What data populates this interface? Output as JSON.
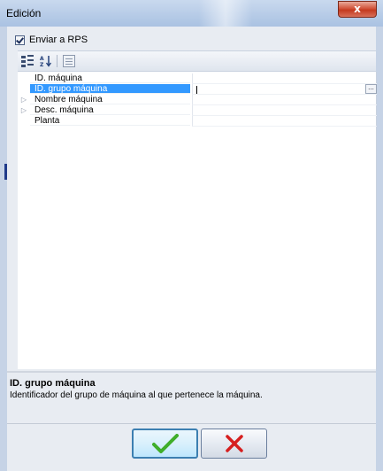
{
  "window": {
    "title": "Edición",
    "close_glyph": "x"
  },
  "send_checkbox": {
    "label": "Enviar a RPS",
    "checked": true
  },
  "toolbar": {
    "icons": [
      "categorized-icon",
      "alphabetical-sort-icon",
      "property-pages-icon"
    ],
    "sort_glyph": "A↓Z"
  },
  "properties": [
    {
      "name": "ID. máquina",
      "value": "",
      "expandable": false,
      "selected": false
    },
    {
      "name": "ID. grupo máquina",
      "value": "",
      "expandable": false,
      "selected": true
    },
    {
      "name": "Nombre máquina",
      "value": "",
      "expandable": true,
      "selected": false
    },
    {
      "name": "Desc. máquina",
      "value": "",
      "expandable": true,
      "selected": false
    },
    {
      "name": "Planta",
      "value": "",
      "expandable": false,
      "selected": false
    }
  ],
  "ellipsis_label": "...",
  "description": {
    "title": "ID. grupo máquina",
    "text": "Identificador del grupo de máquina al que pertenece la máquina."
  },
  "buttons": {
    "ok_icon": "checkmark-icon",
    "cancel_icon": "cross-icon"
  },
  "colors": {
    "selection": "#3399ff",
    "ok_check": "#3fae2a",
    "cancel_x": "#d61f1f"
  }
}
